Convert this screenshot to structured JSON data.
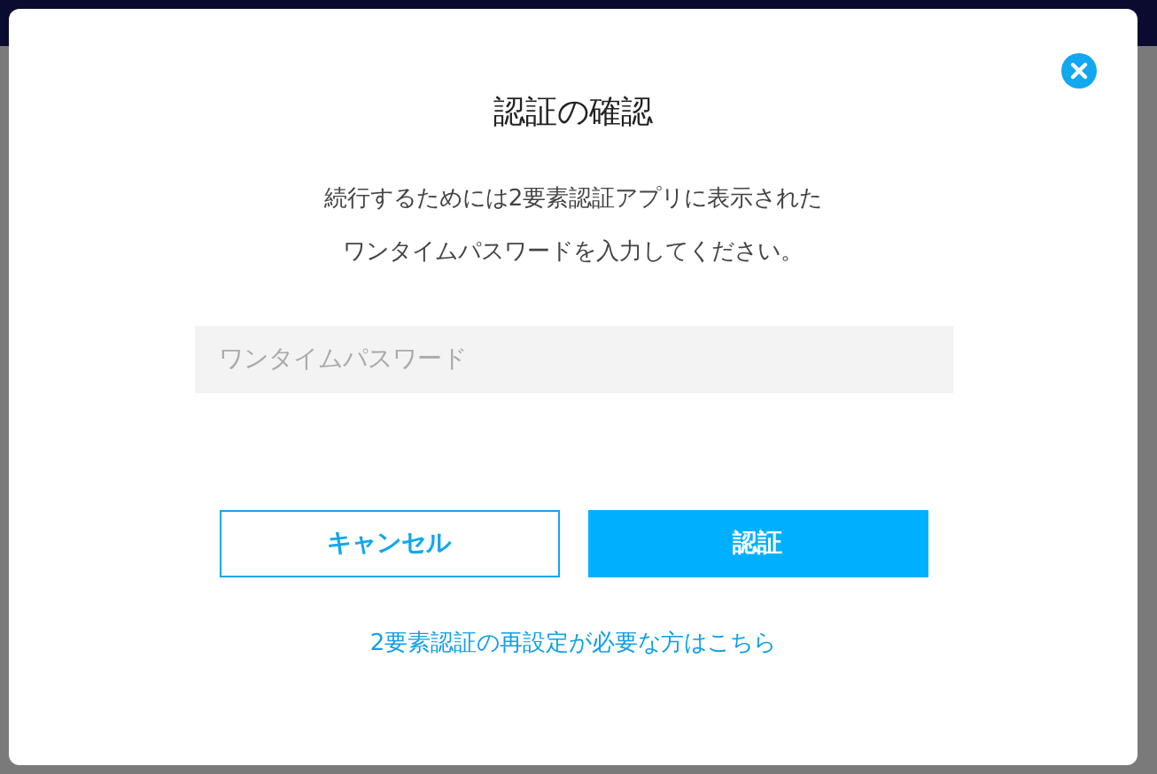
{
  "dialog": {
    "title": "認証の確認",
    "message_lines": [
      "続行するためには2要素認証アプリに表示された",
      "ワンタイムパスワードを入力してください。"
    ],
    "otp_field": {
      "placeholder": "ワンタイムパスワード"
    },
    "buttons": [
      {
        "label": "キャンセル",
        "kind": "secondary"
      },
      {
        "label": "認証",
        "kind": "primary"
      }
    ],
    "reset_link": "2要素認証の再設定が必要な方はこちら"
  }
}
